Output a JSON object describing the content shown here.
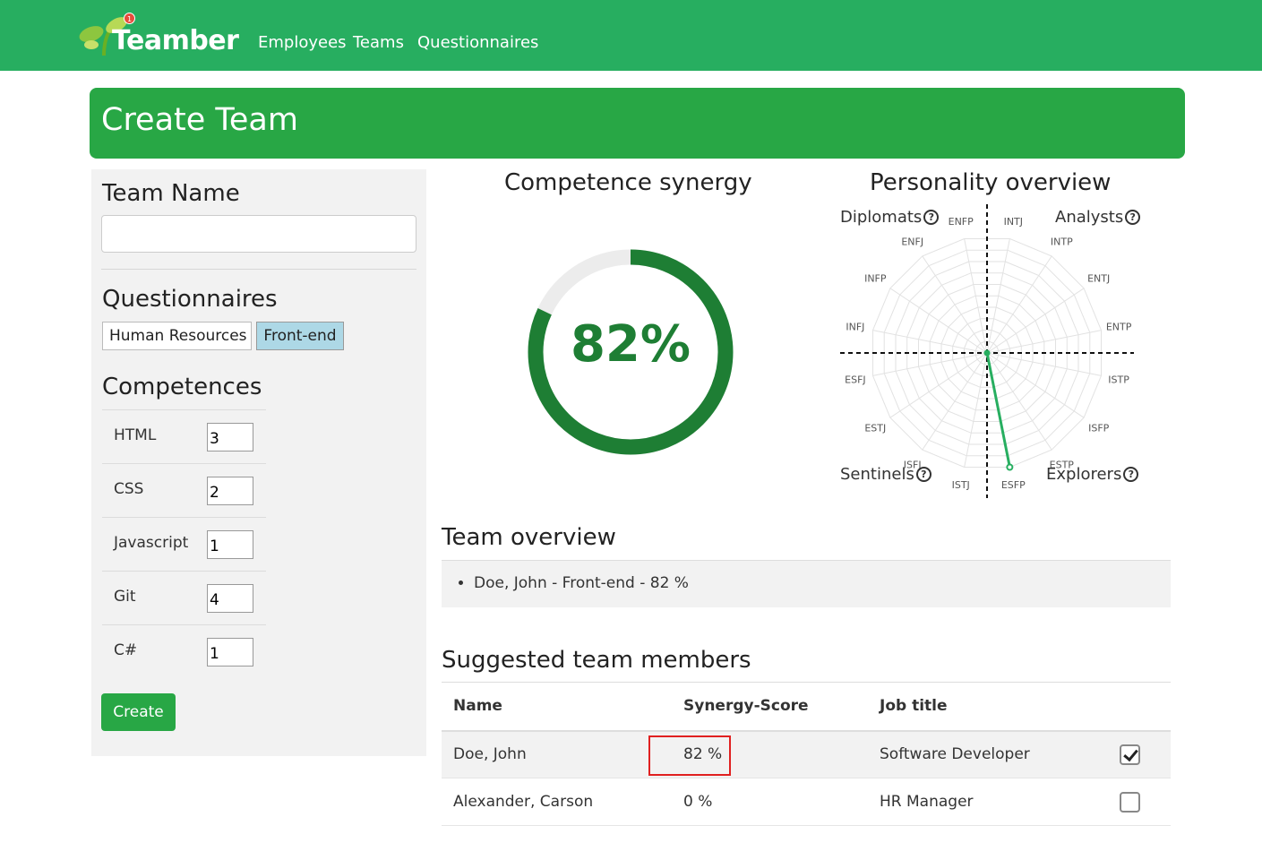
{
  "app": {
    "brand": "Teamber",
    "notification_count": "1",
    "nav": {
      "employees": "Employees",
      "teams": "Teams",
      "questionnaires": "Questionnaires"
    }
  },
  "page": {
    "title": "Create Team"
  },
  "form": {
    "team_name_label": "Team Name",
    "team_name_value": "",
    "questionnaires_label": "Questionnaires",
    "questionnaires": [
      {
        "label": "Human Resources",
        "selected": false
      },
      {
        "label": "Front-end",
        "selected": true
      }
    ],
    "competences_label": "Competences",
    "competences": [
      {
        "name": "HTML",
        "value": "3"
      },
      {
        "name": "CSS",
        "value": "2"
      },
      {
        "name": "Javascript",
        "value": "1"
      },
      {
        "name": "Git",
        "value": "4"
      },
      {
        "name": "C#",
        "value": "1"
      }
    ],
    "create_label": "Create"
  },
  "synergy": {
    "title": "Competence synergy",
    "value": "82%",
    "fraction": 0.82
  },
  "personality": {
    "title": "Personality overview",
    "quadrants": {
      "diplomats": "Diplomats",
      "analysts": "Analysts",
      "sentinels": "Sentinels",
      "explorers": "Explorers"
    },
    "types": [
      "INTJ",
      "INTP",
      "ENTJ",
      "ENTP",
      "ISTP",
      "ISFP",
      "ESTP",
      "ESFP",
      "ISTJ",
      "ISFJ",
      "ESTJ",
      "ESFJ",
      "INFJ",
      "INFP",
      "ENFJ",
      "ENFP"
    ],
    "values": [
      0,
      0,
      0,
      0,
      0,
      0,
      0,
      1,
      0,
      0,
      0,
      0,
      0,
      0,
      0,
      0
    ],
    "series_color": "#27ae60"
  },
  "team_overview": {
    "title": "Team overview",
    "items": [
      "Doe, John - Front-end - 82 %"
    ]
  },
  "suggested": {
    "title": "Suggested team members",
    "headers": {
      "name": "Name",
      "score": "Synergy-Score",
      "job": "Job title"
    },
    "rows": [
      {
        "name": "Doe, John",
        "score": "82 %",
        "job": "Software Developer",
        "checked": true
      },
      {
        "name": "Alexander, Carson",
        "score": "0 %",
        "job": "HR Manager",
        "checked": false
      }
    ]
  }
}
